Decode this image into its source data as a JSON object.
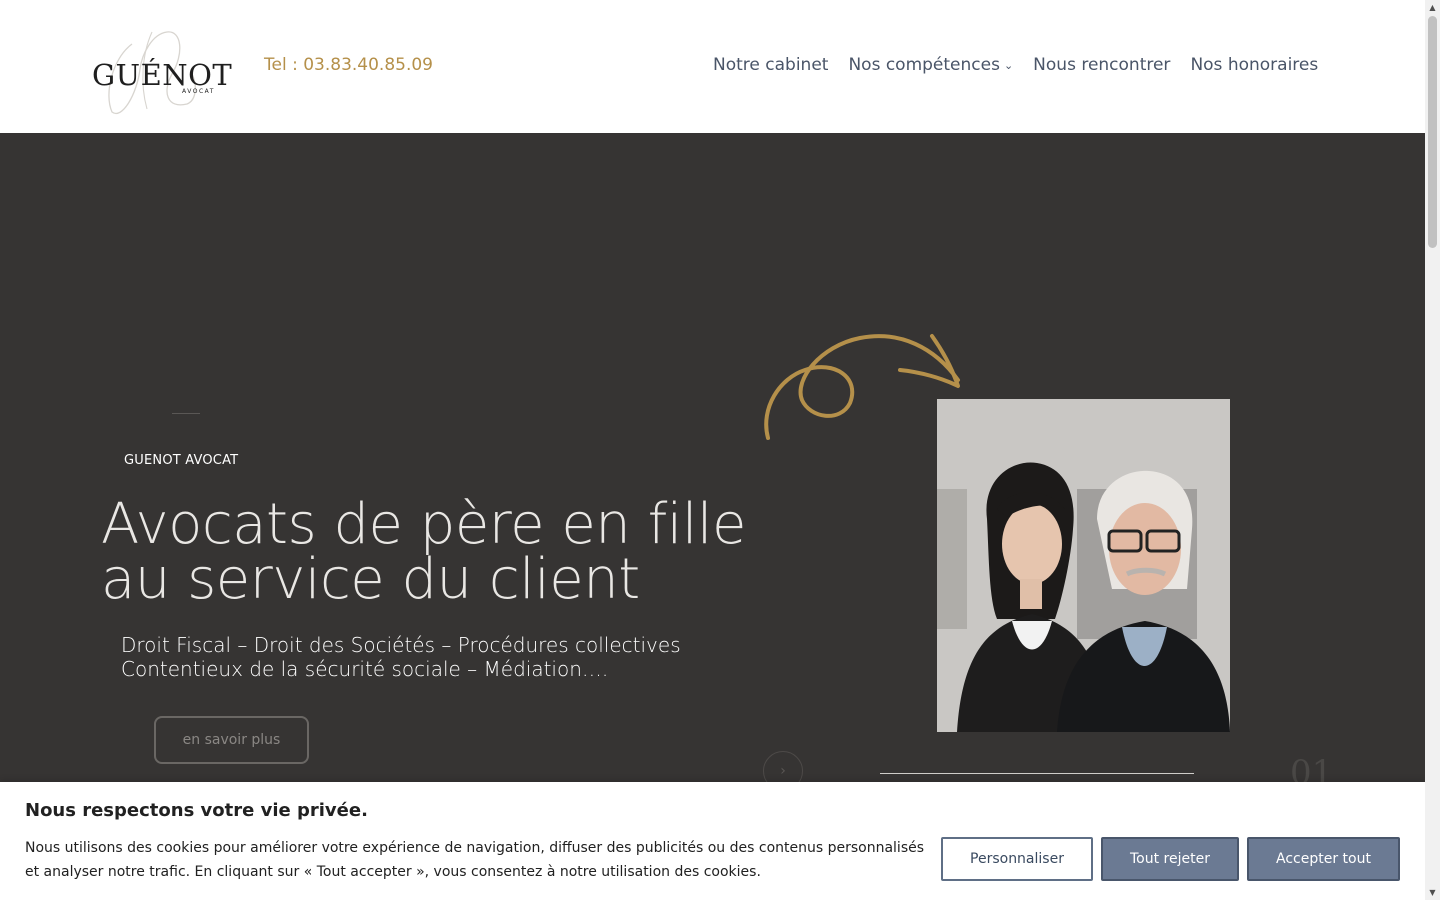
{
  "header": {
    "logo_name": "GUÉNOT",
    "logo_sub": "AVOCAT",
    "phone": "Tel : 03.83.40.85.09",
    "nav": [
      {
        "label": "Notre cabinet"
      },
      {
        "label": "Nos compétences",
        "has_dropdown": true
      },
      {
        "label": "Nous rencontrer"
      },
      {
        "label": "Nos honoraires"
      }
    ]
  },
  "hero": {
    "eyebrow": "GUENOT AVOCAT",
    "headline_line1": "Avocats de père en fille",
    "headline_line2": "au service du client",
    "subtitle_line1": "Droit Fiscal – Droit des Sociétés – Procédures collectives",
    "subtitle_line2": "Contentieux de la sécurité sociale – Médiation….",
    "cta_label": "en savoir plus",
    "slide_number": "01",
    "arrow_icon": "arrow-right-icon"
  },
  "cookie": {
    "title": "Nous respectons votre vie privée.",
    "text": "Nous utilisons des cookies pour améliorer votre expérience de navigation, diffuser des publicités ou des contenus personnalisés et analyser notre trafic. En cliquant sur « Tout accepter », vous consentez à notre utilisation des cookies.",
    "customize_label": "Personnaliser",
    "reject_label": "Tout rejeter",
    "accept_label": "Accepter tout"
  },
  "colors": {
    "accent_gold": "#b5904a",
    "hero_bg": "#363433",
    "button_blue": "#6b7a93"
  }
}
